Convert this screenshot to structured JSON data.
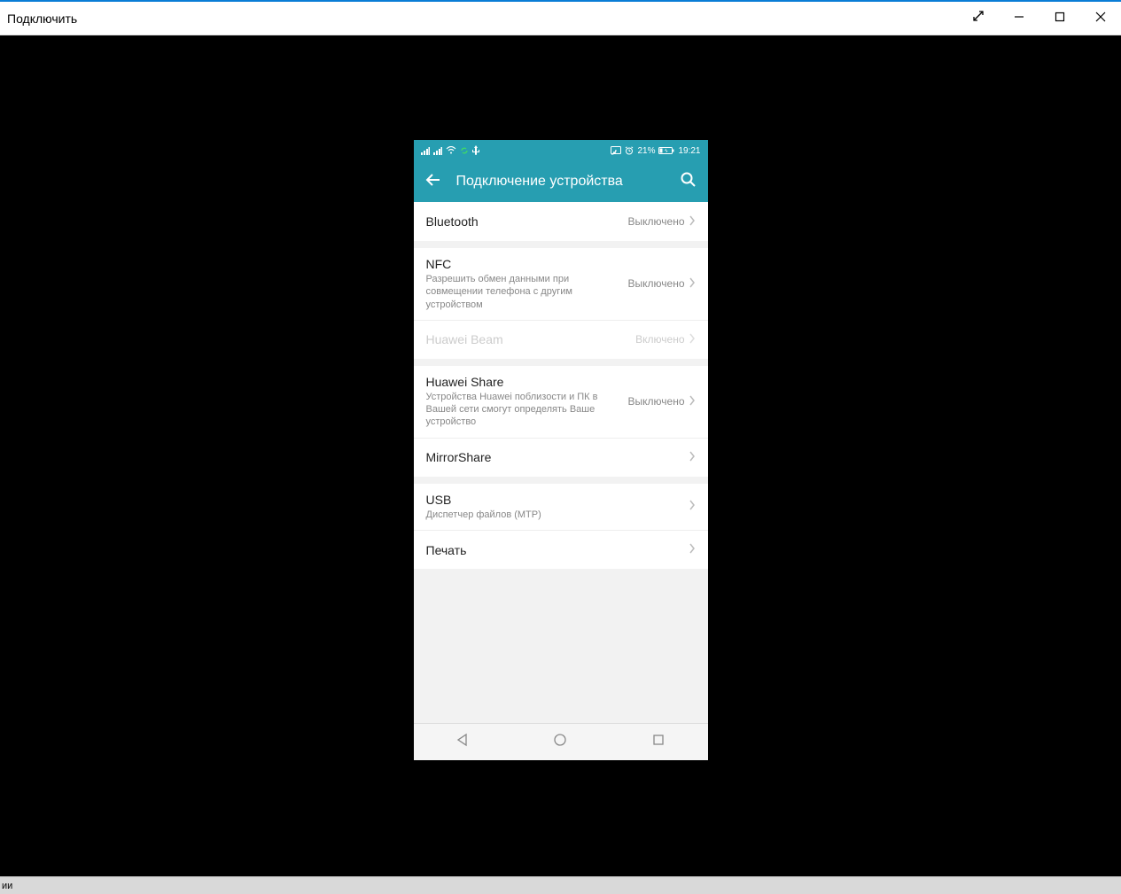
{
  "window": {
    "title": "Подключить"
  },
  "phone": {
    "statusbar": {
      "battery": "21%",
      "time": "19:21",
      "alarm_icon": "alarm-icon"
    },
    "appbar": {
      "title": "Подключение устройства"
    },
    "rows": {
      "bluetooth": {
        "title": "Bluetooth",
        "value": "Выключено"
      },
      "nfc": {
        "title": "NFC",
        "sub": "Разрешить обмен данными при совмещении телефона с другим устройством",
        "value": "Выключено"
      },
      "beam": {
        "title": "Huawei Beam",
        "value": "Включено"
      },
      "share": {
        "title": "Huawei Share",
        "sub": "Устройства Huawei поблизости и ПК в Вашей сети смогут определять Ваше устройство",
        "value": "Выключено"
      },
      "mirror": {
        "title": "MirrorShare"
      },
      "usb": {
        "title": "USB",
        "sub": "Диспетчер файлов (MTP)"
      },
      "print": {
        "title": "Печать"
      }
    }
  },
  "bottom_snippet": "ии"
}
